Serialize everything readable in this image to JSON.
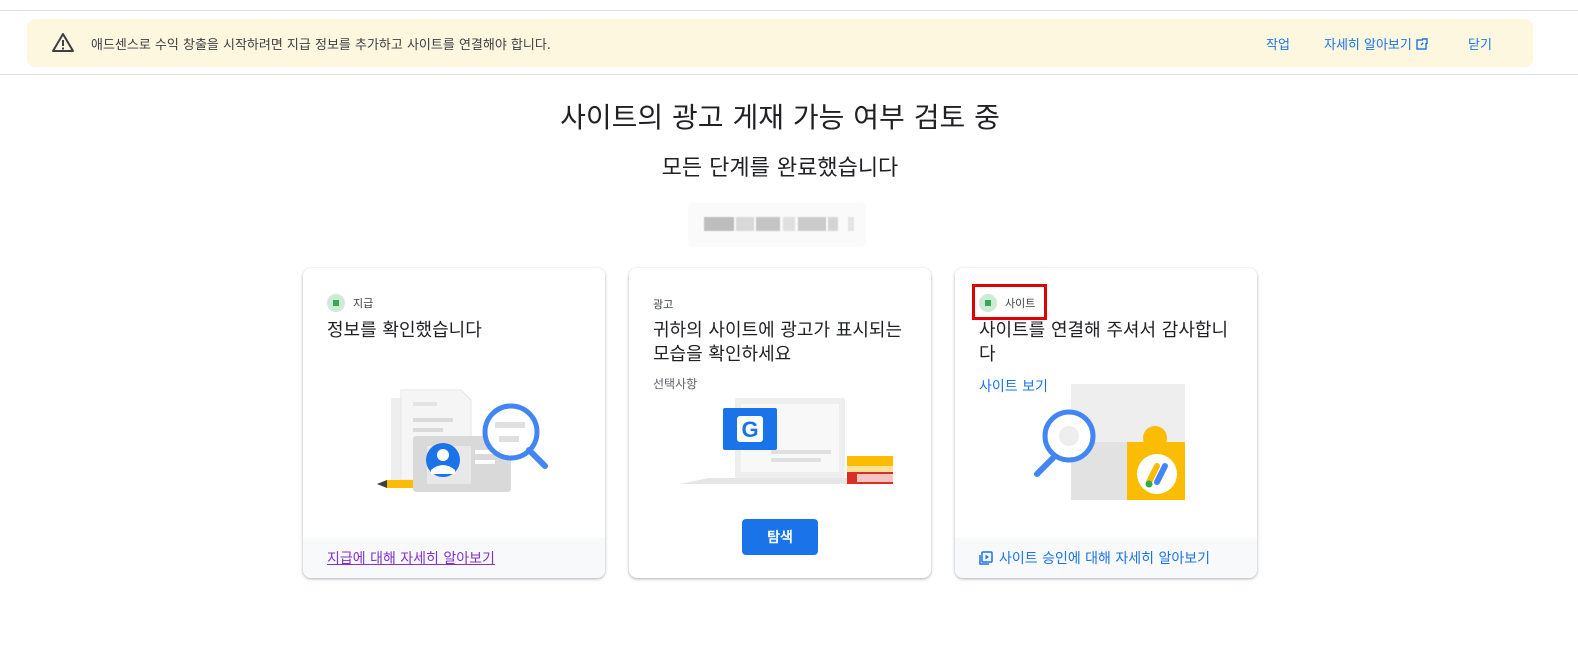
{
  "banner": {
    "message": "애드센스로 수익 창출을 시작하려면 지급 정보를 추가하고 사이트를 연결해야 합니다.",
    "action_label": "작업",
    "learn_more_label": "자세히 알아보기",
    "close_label": "닫기"
  },
  "header": {
    "title": "사이트의 광고 게재 가능 여부 검토 중",
    "subtitle": "모든 단계를 완료했습니다"
  },
  "cards": [
    {
      "status_label": "지급",
      "heading": "정보를 확인했습니다",
      "footer_link": "지급에 대해 자세히 알아보기"
    },
    {
      "status_label": "광고",
      "heading": "귀하의 사이트에 광고가 표시되는 모습을 확인하세요",
      "optional_label": "선택사항",
      "button_label": "탐색"
    },
    {
      "status_label": "사이트",
      "heading": "사이트를 연결해 주셔서 감사합니다",
      "view_site_link": "사이트 보기",
      "footer_link": "사이트 승인에 대해 자세히 알아보기"
    }
  ],
  "colors": {
    "accent": "#1a73e8",
    "banner_bg": "#fef7e0",
    "status_green": "#34a853",
    "visited_link": "#8430ce",
    "highlight": "#e00000"
  }
}
